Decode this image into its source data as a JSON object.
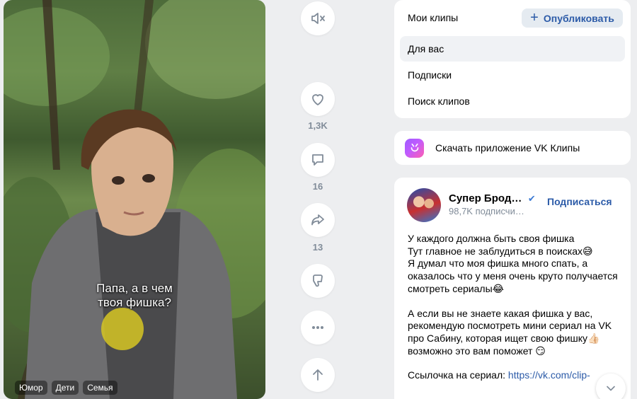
{
  "video": {
    "caption_line1": "Папа, а в чем",
    "caption_line2": "твоя фишка?",
    "tags": [
      "Юмор",
      "Дети",
      "Семья"
    ]
  },
  "actions": {
    "mute_icon": "volume-muted-icon",
    "like_count": "1,3K",
    "comment_count": "16",
    "share_count": "13",
    "icons": [
      "heart-icon",
      "comment-icon",
      "share-icon",
      "dislike-icon",
      "more-icon",
      "arrow-up-icon"
    ]
  },
  "menu": {
    "my_clips": "Мои клипы",
    "publish": "Опубликовать",
    "for_you": "Для вас",
    "subscriptions": "Подписки",
    "search": "Поиск клипов"
  },
  "download": {
    "label": "Скачать приложение VK Клипы"
  },
  "author": {
    "name": "Супер Брод…",
    "subscribers": "98,7K подписчи…",
    "subscribe": "Подписаться",
    "para1": "У каждого должна быть своя фишка\nТут главное не заблудиться в поисках😅\nЯ думал что моя фишка много спать, а оказалось что у меня очень круто получается смотреть сериалы😂",
    "para2": "А если вы не знаете какая фишка у вас, рекомендую посмотреть мини сериал на VK про Сабину, которая ищет свою фишку👍🏻 возможно это вам поможет 😏",
    "link_prefix": "Ссылочка на сериал: ",
    "link": "https://vk.com/clip-"
  },
  "colors": {
    "accent": "#2c5ba8",
    "muted": "#818c99",
    "background": "#edeef0"
  }
}
